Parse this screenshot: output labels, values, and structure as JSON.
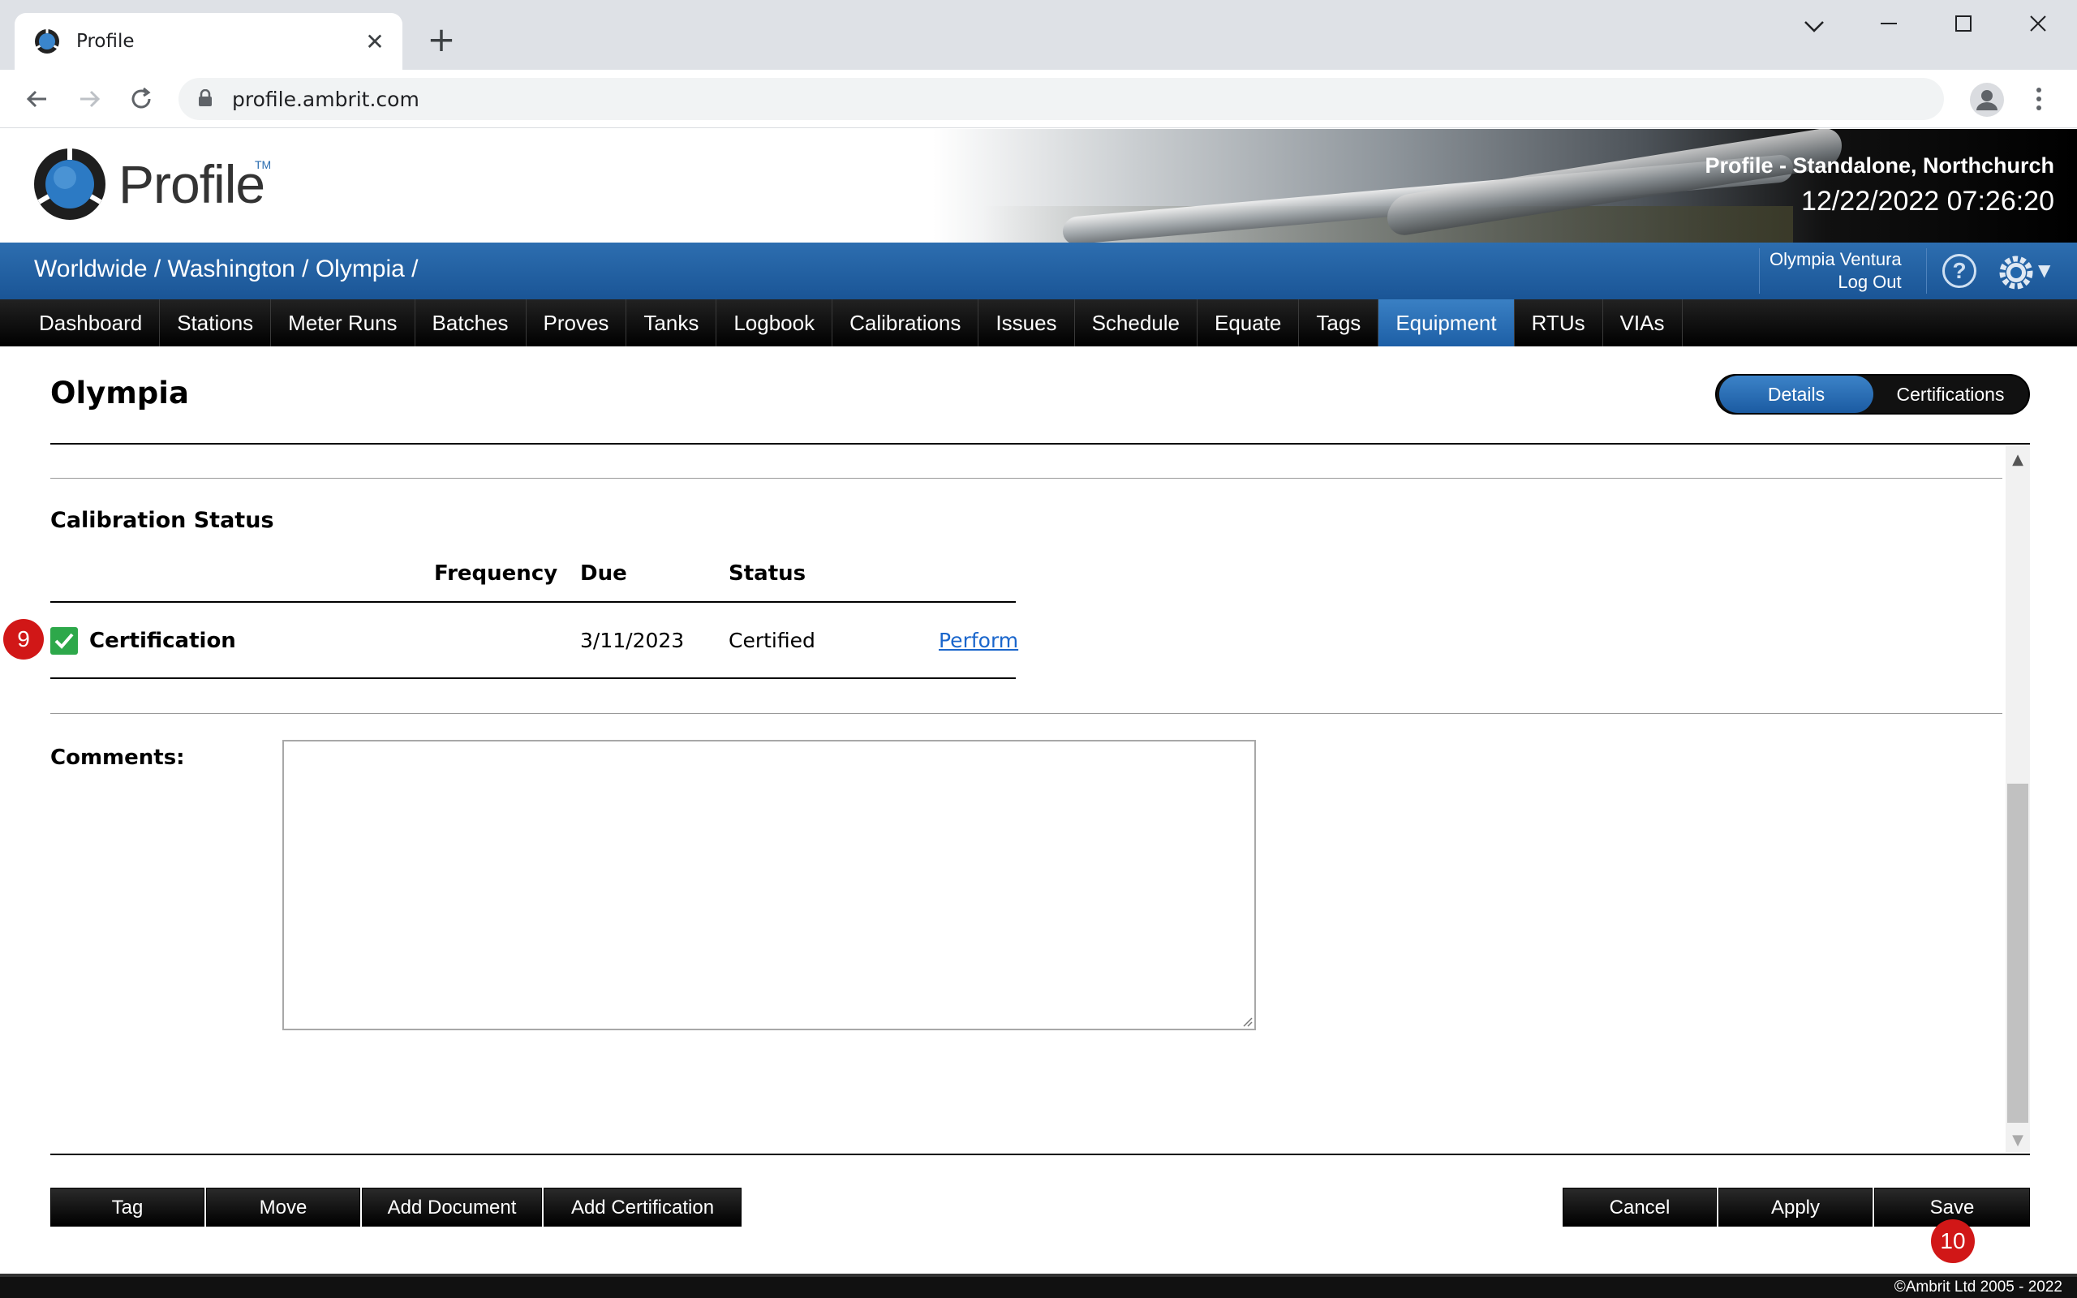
{
  "browser": {
    "tab_title": "Profile",
    "url": "profile.ambrit.com",
    "new_tab_glyph": "+",
    "close_glyph": "✕"
  },
  "header": {
    "logo_text": "Profile",
    "logo_tm": "TM",
    "site_name": "Profile - Standalone, Northchurch",
    "datetime": "12/22/2022 07:26:20"
  },
  "breadcrumb": "Worldwide / Washington / Olympia /",
  "user": {
    "name": "Olympia Ventura",
    "logout": "Log Out",
    "help": "?"
  },
  "nav": {
    "items": [
      "Dashboard",
      "Stations",
      "Meter Runs",
      "Batches",
      "Proves",
      "Tanks",
      "Logbook",
      "Calibrations",
      "Issues",
      "Schedule",
      "Equate",
      "Tags",
      "Equipment",
      "RTUs",
      "VIAs"
    ],
    "active": "Equipment"
  },
  "page": {
    "title": "Olympia",
    "segments": {
      "details": "Details",
      "certifications": "Certifications"
    }
  },
  "calibration": {
    "section_title": "Calibration Status",
    "columns": {
      "frequency": "Frequency",
      "due": "Due",
      "status": "Status"
    },
    "row": {
      "badge": "9",
      "name": "Certification",
      "frequency": "",
      "due": "3/11/2023",
      "status": "Certified",
      "action": "Perform"
    }
  },
  "comments": {
    "label": "Comments:",
    "value": ""
  },
  "buttons": {
    "tag": "Tag",
    "move": "Move",
    "add_document": "Add Document",
    "add_certification": "Add Certification",
    "cancel": "Cancel",
    "apply": "Apply",
    "save": "Save",
    "save_badge": "10"
  },
  "footer": "©Ambrit Ltd 2005 - 2022",
  "colors": {
    "accent_blue": "#1d5fa6",
    "nav_black": "#000000",
    "badge_red": "#d11717",
    "check_green": "#2da84a",
    "link_blue": "#1a66cc"
  }
}
